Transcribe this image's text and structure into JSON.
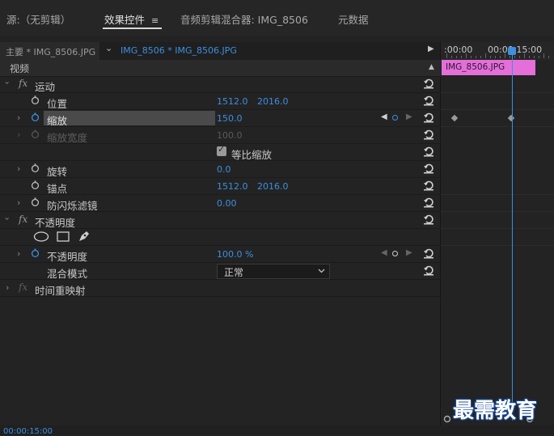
{
  "tabs": {
    "source": "源:（无剪辑）",
    "effect_controls": "效果控件",
    "menu_glyph": "≡",
    "audio_mixer": "音频剪辑混合器: IMG_8506",
    "metadata": "元数据"
  },
  "source_bar": {
    "master": "主要 * IMG_8506.JPG",
    "chevron": "⌄",
    "sequence": "IMG_8506 * IMG_8506.JPG",
    "play": "▶"
  },
  "timeline": {
    "ruler_left": ":00:00",
    "ruler_right": "00:00:15:00",
    "clip_label": "IMG_8506.JPG",
    "scroll_up": "▲"
  },
  "sections": {
    "video": "视频",
    "motion": "运动",
    "opacity_group": "不透明度",
    "time_remap": "时间重映射"
  },
  "params": {
    "position": {
      "label": "位置",
      "x": "1512.0",
      "y": "2016.0"
    },
    "scale": {
      "label": "缩放",
      "value": "150.0"
    },
    "scale_width": {
      "label": "缩放宽度",
      "value": "100.0"
    },
    "uniform_scale": {
      "label": "等比缩放",
      "checked": true
    },
    "rotation": {
      "label": "旋转",
      "value": "0.0"
    },
    "anchor": {
      "label": "锚点",
      "x": "1512.0",
      "y": "2016.0"
    },
    "anti_flicker": {
      "label": "防闪烁滤镜",
      "value": "0.00"
    },
    "opacity": {
      "label": "不透明度",
      "value": "100.0 %"
    },
    "blend_mode": {
      "label": "混合模式",
      "value": "正常"
    }
  },
  "fx_label": "fx",
  "footer": {
    "timecode": "00:00:15:00",
    "watermark": "最需教育"
  },
  "colors": {
    "accent": "#3d8fe0",
    "clip": "#e46fd9",
    "background": "#232323"
  }
}
